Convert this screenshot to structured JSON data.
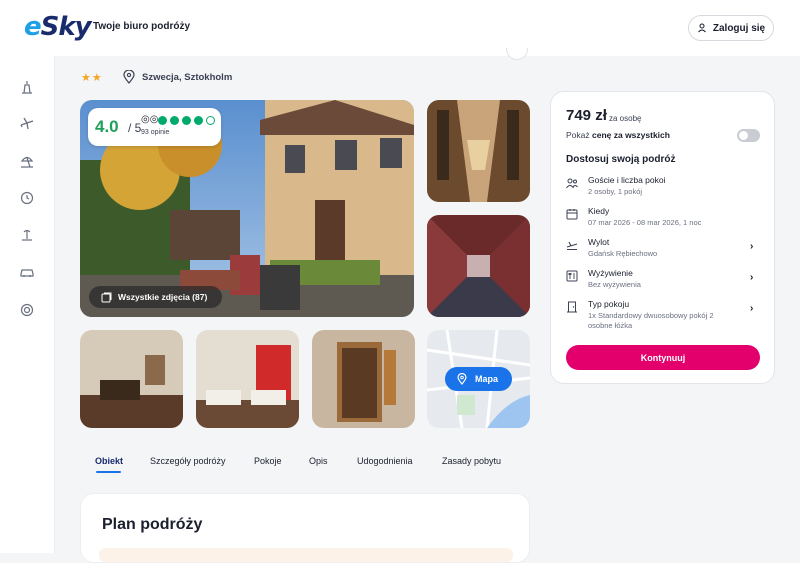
{
  "header": {
    "logo_text": "eSky",
    "tagline": "Twoje biuro podróży",
    "login_label": "Zaloguj się"
  },
  "sidebar": {
    "items": [
      {
        "icon": "hotel-icon"
      },
      {
        "icon": "plane-icon"
      },
      {
        "icon": "beach-icon"
      },
      {
        "icon": "clock-icon"
      },
      {
        "icon": "island-icon"
      },
      {
        "icon": "car-icon"
      },
      {
        "icon": "lifebuoy-icon"
      }
    ]
  },
  "hotel": {
    "stars": "★★",
    "location": "Szwecja, Sztokholm",
    "rating_score": "4.0",
    "rating_of": "/ 5",
    "review_count": "93 opinie",
    "tripadvisor_dots": 4,
    "all_photos_label": "Wszystkie zdjęcia (87)",
    "map_label": "Mapa"
  },
  "tabs": [
    "Obiekt",
    "Szczegóły podróży",
    "Pokoje",
    "Opis",
    "Udogodnienia",
    "Zasady pobytu"
  ],
  "plan": {
    "title": "Plan podróży"
  },
  "booking": {
    "price": "749 zł",
    "per_person": "za osobę",
    "toggle_prefix": "Pokaż",
    "toggle_bold": "cenę za wszystkich",
    "section_title": "Dostosuj swoją podróż",
    "rows": [
      {
        "title": "Goście i liczba pokoi",
        "value": "2 osoby, 1 pokój",
        "icon": "guests-icon"
      },
      {
        "title": "Kiedy",
        "value": "07 mar 2026 - 08 mar 2026, 1 noc",
        "icon": "calendar-icon"
      },
      {
        "title": "Wylot",
        "value": "Gdańsk Rębiechowo",
        "icon": "departure-icon"
      },
      {
        "title": "Wyżywienie",
        "value": "Bez wyżywienia",
        "icon": "meal-icon"
      },
      {
        "title": "Typ pokoju",
        "value": "1x Standardowy dwuosobowy pokój 2 osobne łóżka",
        "icon": "door-icon"
      }
    ],
    "continue_label": "Kontynuuj"
  },
  "colors": {
    "accent_pink": "#e3006d",
    "accent_blue": "#1a73e8",
    "rating_green": "#1ea05a"
  }
}
